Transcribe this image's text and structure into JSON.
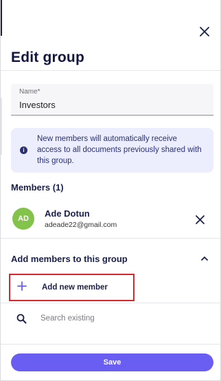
{
  "dialog": {
    "title": "Edit group"
  },
  "name_field": {
    "label": "Name*",
    "value": "Investors"
  },
  "info": {
    "text": "New members will automatically receive access to all documents previously shared with this group.",
    "icon": "info-icon"
  },
  "members": {
    "title": "Members (1)",
    "items": [
      {
        "initials": "AD",
        "name": "Ade Dotun",
        "email": "adeade22@gmail.com",
        "avatar_color": "#83c34b"
      }
    ]
  },
  "add_members": {
    "title": "Add members to this group",
    "add_new_label": "Add new member",
    "search_placeholder": "Search existing"
  },
  "footer": {
    "save_label": "Save"
  },
  "colors": {
    "accent": "#6a5ef2",
    "info_bg": "#eceefe",
    "highlight_border": "#d9252b",
    "title": "#111640"
  }
}
